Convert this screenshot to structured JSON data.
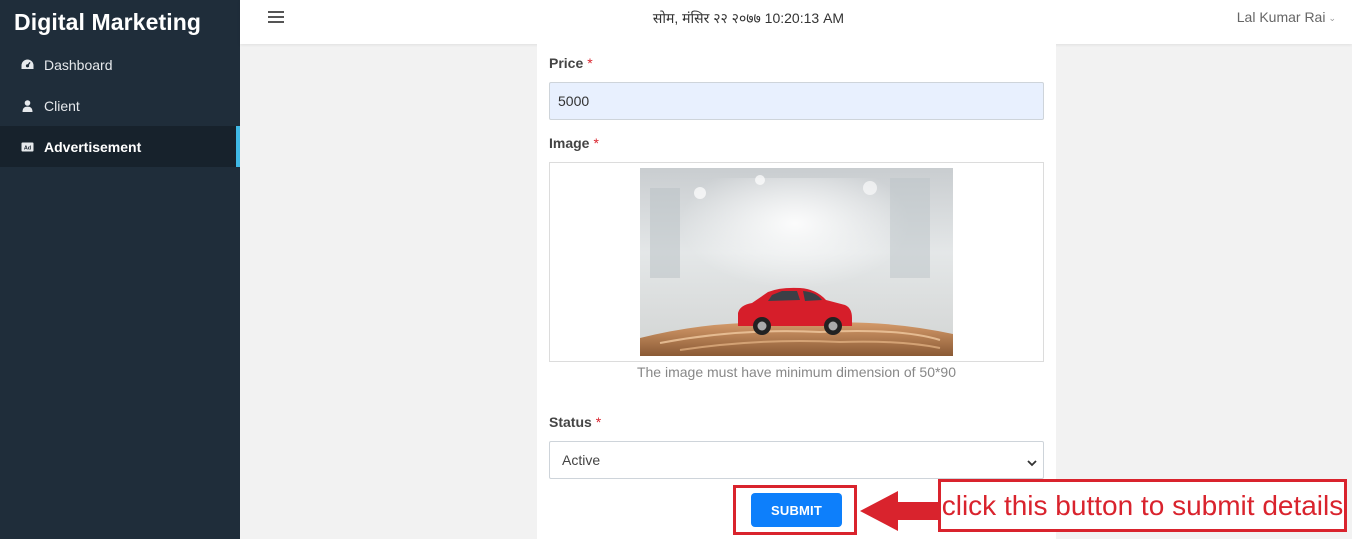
{
  "app": {
    "title": "Digital Marketing"
  },
  "sidebar": {
    "items": [
      {
        "label": "Dashboard",
        "icon": "dashboard-icon"
      },
      {
        "label": "Client",
        "icon": "user-icon"
      },
      {
        "label": "Advertisement",
        "icon": "ad-icon",
        "active": true
      }
    ]
  },
  "topbar": {
    "datetime": "सोम, मंसिर २२ २०७७ 10:20:13 AM",
    "user": "Lal Kumar Rai"
  },
  "form": {
    "price": {
      "label": "Price",
      "required_mark": "*",
      "value": "5000"
    },
    "image": {
      "label": "Image",
      "required_mark": "*",
      "hint": "The image must have minimum dimension of 50*90"
    },
    "status": {
      "label": "Status",
      "required_mark": "*",
      "value": "Active"
    },
    "submit_label": "SUBMIT"
  },
  "annotation": {
    "text": "click this button to submit details",
    "color": "#d9232d"
  },
  "colors": {
    "sidebar_bg": "#1f2d3a",
    "active_accent": "#3fb8e5",
    "button_primary": "#0d7ffb",
    "autofill_bg": "#e8f0fe"
  }
}
